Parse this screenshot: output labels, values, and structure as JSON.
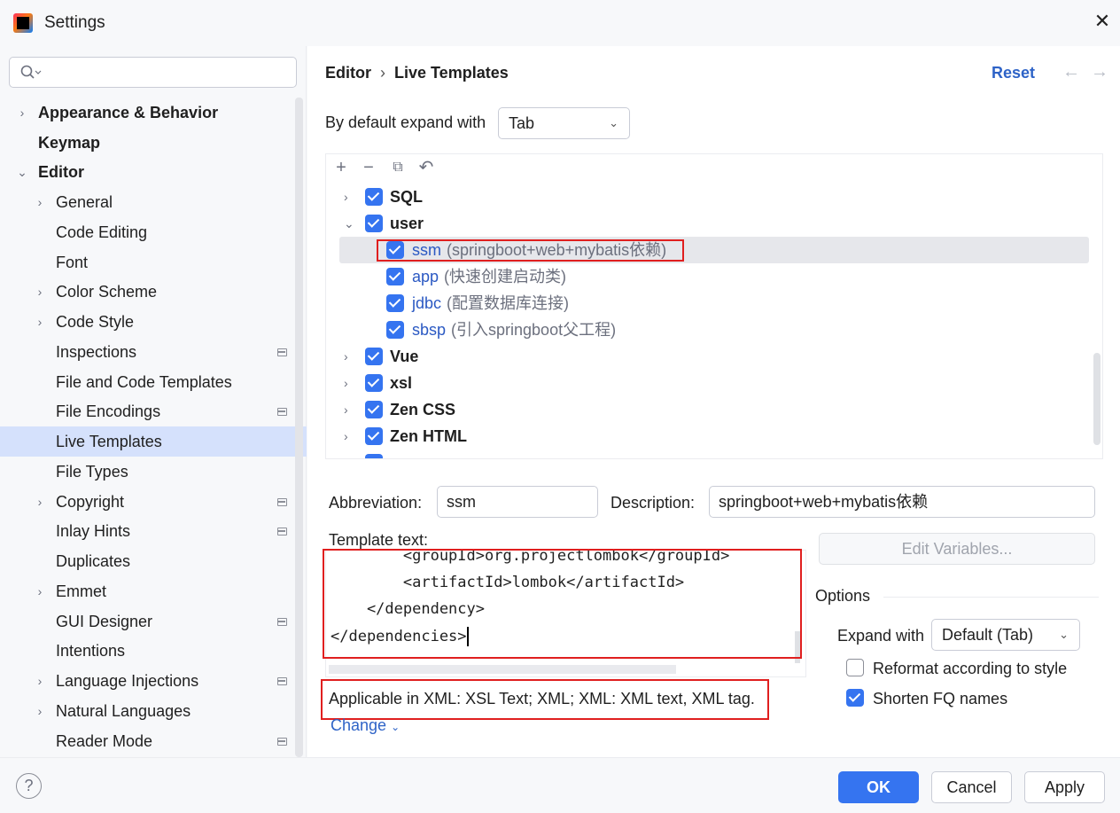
{
  "window": {
    "title": "Settings"
  },
  "search": {
    "placeholder": ""
  },
  "sidebar": {
    "items": [
      {
        "label": "Appearance & Behavior"
      },
      {
        "label": "Keymap"
      },
      {
        "label": "Editor"
      },
      {
        "label": "General"
      },
      {
        "label": "Code Editing"
      },
      {
        "label": "Font"
      },
      {
        "label": "Color Scheme"
      },
      {
        "label": "Code Style"
      },
      {
        "label": "Inspections"
      },
      {
        "label": "File and Code Templates"
      },
      {
        "label": "File Encodings"
      },
      {
        "label": "Live Templates"
      },
      {
        "label": "File Types"
      },
      {
        "label": "Copyright"
      },
      {
        "label": "Inlay Hints"
      },
      {
        "label": "Duplicates"
      },
      {
        "label": "Emmet"
      },
      {
        "label": "GUI Designer"
      },
      {
        "label": "Intentions"
      },
      {
        "label": "Language Injections"
      },
      {
        "label": "Natural Languages"
      },
      {
        "label": "Reader Mode"
      }
    ]
  },
  "header": {
    "crumb1": "Editor",
    "crumb2": "Live Templates",
    "reset": "Reset"
  },
  "expand": {
    "label": "By default expand with",
    "value": "Tab"
  },
  "templates": {
    "groups": [
      {
        "name": "SQL"
      },
      {
        "name": "user"
      },
      {
        "name": "Vue"
      },
      {
        "name": "xsl"
      },
      {
        "name": "Zen CSS"
      },
      {
        "name": "Zen HTML"
      }
    ],
    "items": [
      {
        "abbr": "ssm",
        "desc": "(springboot+web+mybatis依赖)"
      },
      {
        "abbr": "app",
        "desc": "(快速创建启动类)"
      },
      {
        "abbr": "jdbc",
        "desc": "(配置数据库连接)"
      },
      {
        "abbr": "sbsp",
        "desc": "(引入springboot父工程)"
      }
    ]
  },
  "form": {
    "abbreviation_label": "Abbreviation:",
    "abbreviation_value": "ssm",
    "description_label": "Description:",
    "description_value": "springboot+web+mybatis依赖",
    "template_text_label": "Template text:",
    "edit_variables": "Edit Variables..."
  },
  "editor": {
    "lines": [
      "        <groupId>org.projectlombok</groupId>",
      "        <artifactId>lombok</artifactId>",
      "    </dependency>",
      "</dependencies>"
    ]
  },
  "options": {
    "title": "Options",
    "expand_with_label": "Expand with",
    "expand_with_value": "Default (Tab)",
    "reformat_label": "Reformat according to style",
    "reformat_checked": false,
    "shorten_label": "Shorten FQ names",
    "shorten_checked": true
  },
  "applicable": {
    "text": "Applicable in XML: XSL Text; XML; XML: XML text, XML tag.",
    "change": "Change"
  },
  "footer": {
    "ok": "OK",
    "cancel": "Cancel",
    "apply": "Apply"
  }
}
